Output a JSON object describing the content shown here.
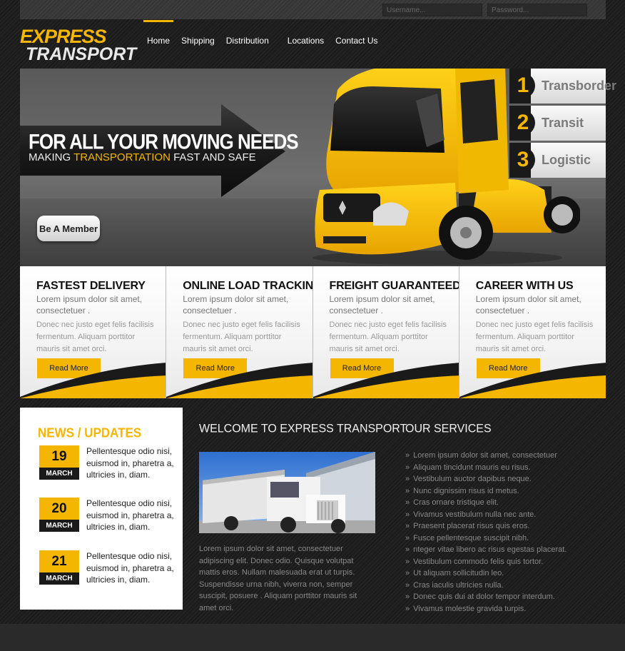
{
  "login": {
    "username_placeholder": "Username...",
    "password_placeholder": "Password..."
  },
  "logo": {
    "line1": "EXPRESS",
    "line2": "TRANSPORT"
  },
  "nav": {
    "items": [
      {
        "label": "Home"
      },
      {
        "label": "Shipping"
      },
      {
        "label": "Distribution"
      },
      {
        "label": "Locations"
      },
      {
        "label": "Contact Us"
      }
    ],
    "active": "Home"
  },
  "hero": {
    "headline": "FOR ALL YOUR MOVING NEEDS",
    "sub_before": "MAKING ",
    "sub_highlight": "TRANSPORTATION",
    "sub_after": "  FAST AND SAFE",
    "member_button": "Be A Member"
  },
  "side_tabs": [
    {
      "number": "1",
      "label": "Transborder"
    },
    {
      "number": "2",
      "label": "Transit"
    },
    {
      "number": "3",
      "label": "Logistic"
    }
  ],
  "features": [
    {
      "title": "FASTEST DELIVERY",
      "lead": "Lorem ipsum dolor sit amet, consectetuer .",
      "body": "Donec nec justo eget felis facilisis fermentum. Aliquam porttitor mauris sit amet orci.",
      "button": "Read More"
    },
    {
      "title": "ONLINE LOAD TRACKING",
      "lead": "Lorem ipsum dolor sit amet, consectetuer .",
      "body": "Donec nec justo eget felis facilisis fermentum. Aliquam porttitor mauris sit amet orci.",
      "button": "Read More"
    },
    {
      "title": "FREIGHT GUARANTEED",
      "lead": "Lorem ipsum dolor sit amet, consectetuer .",
      "body": "Donec nec justo eget felis facilisis fermentum. Aliquam porttitor mauris sit amet orci.",
      "button": "Read More"
    },
    {
      "title": "CAREER WITH US",
      "lead": "Lorem ipsum dolor sit amet, consectetuer .",
      "body": "Donec nec justo eget felis facilisis fermentum. Aliquam porttitor mauris sit amet orci.",
      "button": "Read More"
    }
  ],
  "news": {
    "title": "NEWS / UPDATES",
    "items": [
      {
        "day": "19",
        "month": "MARCH",
        "text": "Pellentesque odio nisi, euismod in, pharetra a, ultricies in, diam."
      },
      {
        "day": "20",
        "month": "MARCH",
        "text": "Pellentesque odio nisi, euismod in, pharetra a, ultricies in, diam."
      },
      {
        "day": "21",
        "month": "MARCH",
        "text": "Pellentesque odio nisi, euismod in, pharetra a, ultricies in, diam."
      }
    ]
  },
  "welcome": {
    "title": "WELCOME  TO EXPRESS TRANSPORT",
    "text": "Lorem ipsum dolor sit amet, consectetuer adipiscing elit. Donec odio. Quisque volutpat mattis eros. Nullam malesuada erat ut turpis. Suspendisse urna nibh, viverra non, semper suscipit, posuere . Aliquam porttitor mauris sit amet orci."
  },
  "services": {
    "title": "OUR SERVICES",
    "bullet": "»",
    "items": [
      "Lorem ipsum dolor sit amet, consectetuer",
      "Aliquam tincidunt mauris eu risus.",
      "Vestibulum auctor dapibus neque.",
      "Nunc dignissim risus id metus.",
      "Cras ornare tristique elit.",
      "Vivamus vestibulum nulla nec ante.",
      "Praesent placerat risus quis eros.",
      "Fusce pellentesque suscipit nibh.",
      "nteger vitae libero ac risus egestas placerat.",
      "Vestibulum commodo felis quis tortor.",
      "Ut aliquam sollicitudin leo.",
      "Cras iaculis ultricies nulla.",
      "Donec quis dui at dolor tempor interdum.",
      "Vivamus molestie gravida turpis."
    ]
  },
  "colors": {
    "accent": "#f5b600",
    "dark": "#1a1a1a"
  }
}
